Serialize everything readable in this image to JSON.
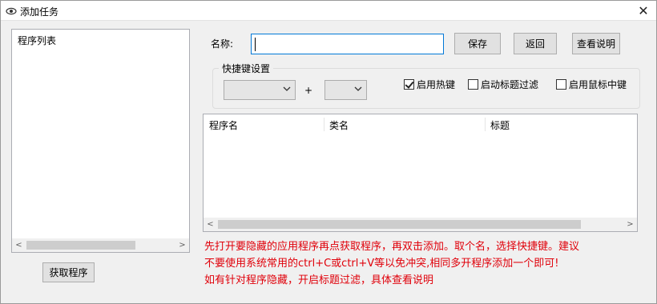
{
  "window": {
    "title": "添加任务",
    "icon": "eye-icon",
    "close_glyph": "✕"
  },
  "program_list": {
    "label": "程序列表"
  },
  "form": {
    "name_label": "名称:",
    "name_value": "",
    "save_label": "保存",
    "back_label": "返回",
    "help_label": "查看说明"
  },
  "hotkey": {
    "legend": "快捷键设置",
    "modifier_value": "",
    "plus": "+",
    "key_value": "",
    "enable_hotkey": {
      "label": "启用热键",
      "checked": true
    },
    "title_filter": {
      "label": "启动标题过滤",
      "checked": false
    },
    "middle_click": {
      "label": "启用鼠标中键",
      "checked": false
    }
  },
  "table": {
    "columns": [
      "程序名",
      "类名",
      "标题"
    ],
    "rows": []
  },
  "fetch_button": "获取程序",
  "hint_lines": [
    "先打开要隐藏的应用程序再点获取程序，再双击添加。取个名，选择快捷键。建议",
    "不要使用系统常用的ctrl+C或ctrl+V等以免冲突,相同多开程序添加一个即可!",
    "如有针对程序隐藏，开启标题过滤，具体查看说明"
  ],
  "colors": {
    "hint": "#e0000a",
    "focus_border": "#0078d7"
  }
}
